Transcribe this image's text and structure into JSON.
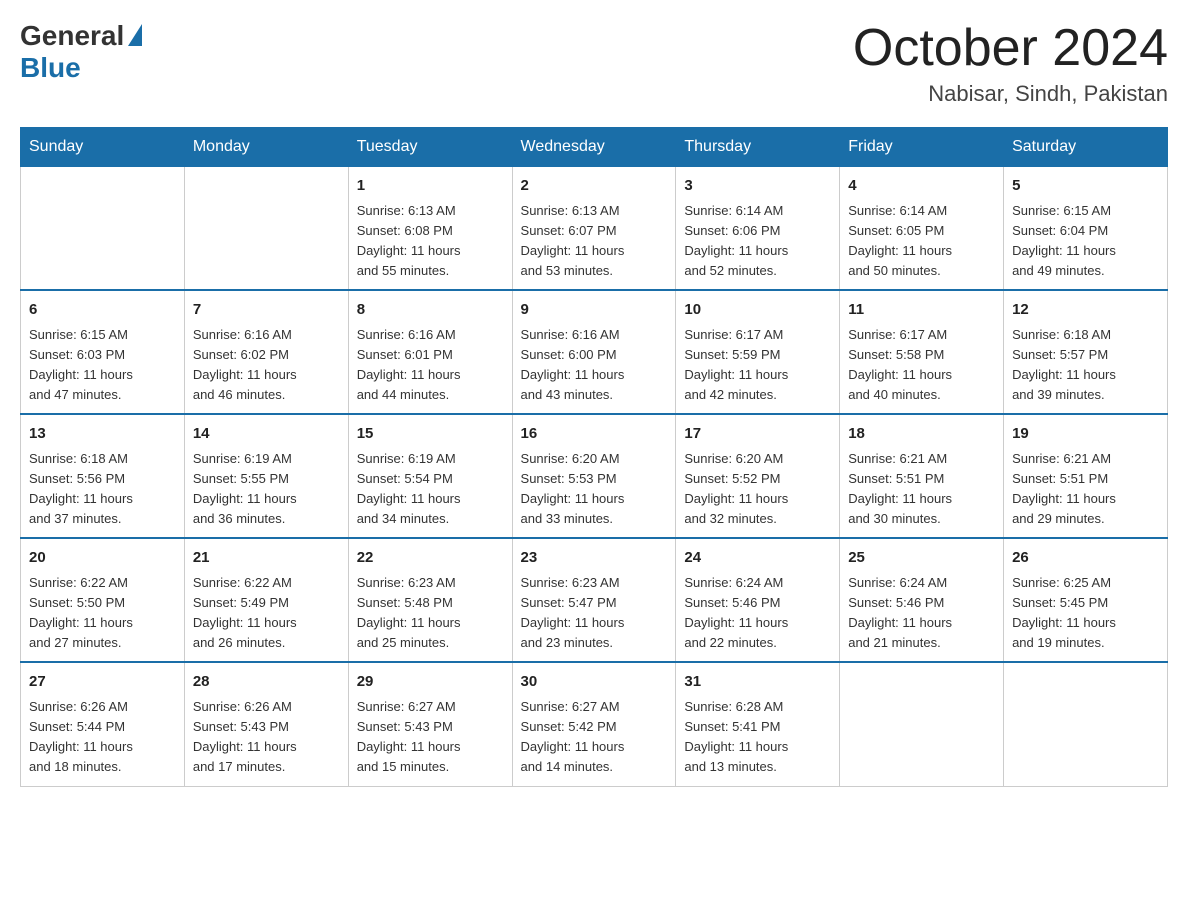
{
  "header": {
    "logo_general": "General",
    "logo_blue": "Blue",
    "month_title": "October 2024",
    "location": "Nabisar, Sindh, Pakistan"
  },
  "days_of_week": [
    "Sunday",
    "Monday",
    "Tuesday",
    "Wednesday",
    "Thursday",
    "Friday",
    "Saturday"
  ],
  "weeks": [
    [
      {
        "day": "",
        "info": ""
      },
      {
        "day": "",
        "info": ""
      },
      {
        "day": "1",
        "info": "Sunrise: 6:13 AM\nSunset: 6:08 PM\nDaylight: 11 hours\nand 55 minutes."
      },
      {
        "day": "2",
        "info": "Sunrise: 6:13 AM\nSunset: 6:07 PM\nDaylight: 11 hours\nand 53 minutes."
      },
      {
        "day": "3",
        "info": "Sunrise: 6:14 AM\nSunset: 6:06 PM\nDaylight: 11 hours\nand 52 minutes."
      },
      {
        "day": "4",
        "info": "Sunrise: 6:14 AM\nSunset: 6:05 PM\nDaylight: 11 hours\nand 50 minutes."
      },
      {
        "day": "5",
        "info": "Sunrise: 6:15 AM\nSunset: 6:04 PM\nDaylight: 11 hours\nand 49 minutes."
      }
    ],
    [
      {
        "day": "6",
        "info": "Sunrise: 6:15 AM\nSunset: 6:03 PM\nDaylight: 11 hours\nand 47 minutes."
      },
      {
        "day": "7",
        "info": "Sunrise: 6:16 AM\nSunset: 6:02 PM\nDaylight: 11 hours\nand 46 minutes."
      },
      {
        "day": "8",
        "info": "Sunrise: 6:16 AM\nSunset: 6:01 PM\nDaylight: 11 hours\nand 44 minutes."
      },
      {
        "day": "9",
        "info": "Sunrise: 6:16 AM\nSunset: 6:00 PM\nDaylight: 11 hours\nand 43 minutes."
      },
      {
        "day": "10",
        "info": "Sunrise: 6:17 AM\nSunset: 5:59 PM\nDaylight: 11 hours\nand 42 minutes."
      },
      {
        "day": "11",
        "info": "Sunrise: 6:17 AM\nSunset: 5:58 PM\nDaylight: 11 hours\nand 40 minutes."
      },
      {
        "day": "12",
        "info": "Sunrise: 6:18 AM\nSunset: 5:57 PM\nDaylight: 11 hours\nand 39 minutes."
      }
    ],
    [
      {
        "day": "13",
        "info": "Sunrise: 6:18 AM\nSunset: 5:56 PM\nDaylight: 11 hours\nand 37 minutes."
      },
      {
        "day": "14",
        "info": "Sunrise: 6:19 AM\nSunset: 5:55 PM\nDaylight: 11 hours\nand 36 minutes."
      },
      {
        "day": "15",
        "info": "Sunrise: 6:19 AM\nSunset: 5:54 PM\nDaylight: 11 hours\nand 34 minutes."
      },
      {
        "day": "16",
        "info": "Sunrise: 6:20 AM\nSunset: 5:53 PM\nDaylight: 11 hours\nand 33 minutes."
      },
      {
        "day": "17",
        "info": "Sunrise: 6:20 AM\nSunset: 5:52 PM\nDaylight: 11 hours\nand 32 minutes."
      },
      {
        "day": "18",
        "info": "Sunrise: 6:21 AM\nSunset: 5:51 PM\nDaylight: 11 hours\nand 30 minutes."
      },
      {
        "day": "19",
        "info": "Sunrise: 6:21 AM\nSunset: 5:51 PM\nDaylight: 11 hours\nand 29 minutes."
      }
    ],
    [
      {
        "day": "20",
        "info": "Sunrise: 6:22 AM\nSunset: 5:50 PM\nDaylight: 11 hours\nand 27 minutes."
      },
      {
        "day": "21",
        "info": "Sunrise: 6:22 AM\nSunset: 5:49 PM\nDaylight: 11 hours\nand 26 minutes."
      },
      {
        "day": "22",
        "info": "Sunrise: 6:23 AM\nSunset: 5:48 PM\nDaylight: 11 hours\nand 25 minutes."
      },
      {
        "day": "23",
        "info": "Sunrise: 6:23 AM\nSunset: 5:47 PM\nDaylight: 11 hours\nand 23 minutes."
      },
      {
        "day": "24",
        "info": "Sunrise: 6:24 AM\nSunset: 5:46 PM\nDaylight: 11 hours\nand 22 minutes."
      },
      {
        "day": "25",
        "info": "Sunrise: 6:24 AM\nSunset: 5:46 PM\nDaylight: 11 hours\nand 21 minutes."
      },
      {
        "day": "26",
        "info": "Sunrise: 6:25 AM\nSunset: 5:45 PM\nDaylight: 11 hours\nand 19 minutes."
      }
    ],
    [
      {
        "day": "27",
        "info": "Sunrise: 6:26 AM\nSunset: 5:44 PM\nDaylight: 11 hours\nand 18 minutes."
      },
      {
        "day": "28",
        "info": "Sunrise: 6:26 AM\nSunset: 5:43 PM\nDaylight: 11 hours\nand 17 minutes."
      },
      {
        "day": "29",
        "info": "Sunrise: 6:27 AM\nSunset: 5:43 PM\nDaylight: 11 hours\nand 15 minutes."
      },
      {
        "day": "30",
        "info": "Sunrise: 6:27 AM\nSunset: 5:42 PM\nDaylight: 11 hours\nand 14 minutes."
      },
      {
        "day": "31",
        "info": "Sunrise: 6:28 AM\nSunset: 5:41 PM\nDaylight: 11 hours\nand 13 minutes."
      },
      {
        "day": "",
        "info": ""
      },
      {
        "day": "",
        "info": ""
      }
    ]
  ]
}
